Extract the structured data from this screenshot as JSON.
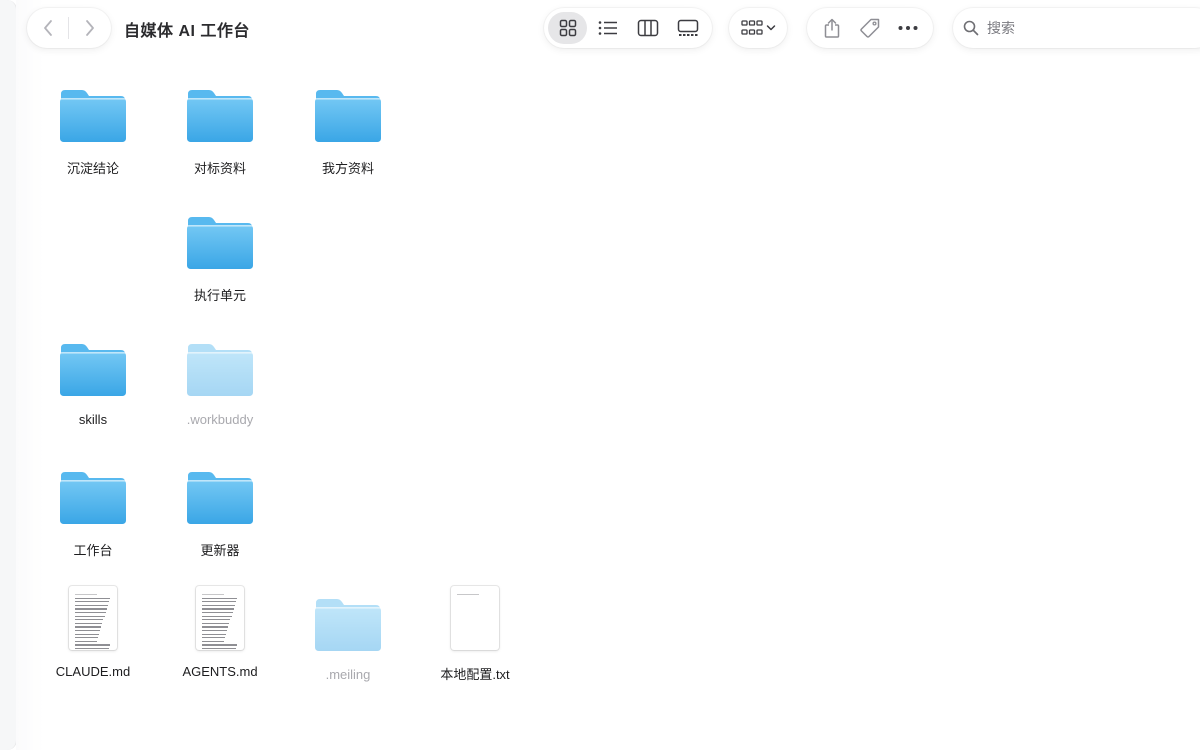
{
  "window": {
    "title": "自媒体 AI 工作台"
  },
  "search": {
    "placeholder": "搜索",
    "value": ""
  },
  "toolbar": {
    "view_modes": [
      "icon-view",
      "list-view",
      "column-view",
      "gallery-view"
    ],
    "active_view": "icon-view",
    "group_menu": "group-by-icon",
    "actions": [
      "share-icon",
      "tag-icon",
      "more-icon"
    ]
  },
  "items": [
    {
      "name": "沉淀结论",
      "kind": "folder",
      "hidden": false
    },
    {
      "name": "对标资料",
      "kind": "folder",
      "hidden": false
    },
    {
      "name": "我方资料",
      "kind": "folder",
      "hidden": false
    },
    {
      "name": "执行单元",
      "kind": "folder",
      "hidden": false
    },
    {
      "name": "skills",
      "kind": "folder",
      "hidden": false
    },
    {
      "name": ".workbuddy",
      "kind": "folder",
      "hidden": true
    },
    {
      "name": "工作台",
      "kind": "folder",
      "hidden": false
    },
    {
      "name": "更新器",
      "kind": "folder",
      "hidden": false
    },
    {
      "name": "CLAUDE.md",
      "kind": "markdown-file",
      "hidden": false
    },
    {
      "name": "AGENTS.md",
      "kind": "markdown-file",
      "hidden": false
    },
    {
      "name": ".meiling",
      "kind": "folder",
      "hidden": true
    },
    {
      "name": "本地配置.txt",
      "kind": "text-file",
      "hidden": false
    }
  ],
  "colors": {
    "folder_top": "#74c8f4",
    "folder_bottom": "#3aa6e6",
    "folder_back": "#58b9ef",
    "hidden_opacity": "0.45",
    "accent_active_view": "#e6e6e8"
  }
}
